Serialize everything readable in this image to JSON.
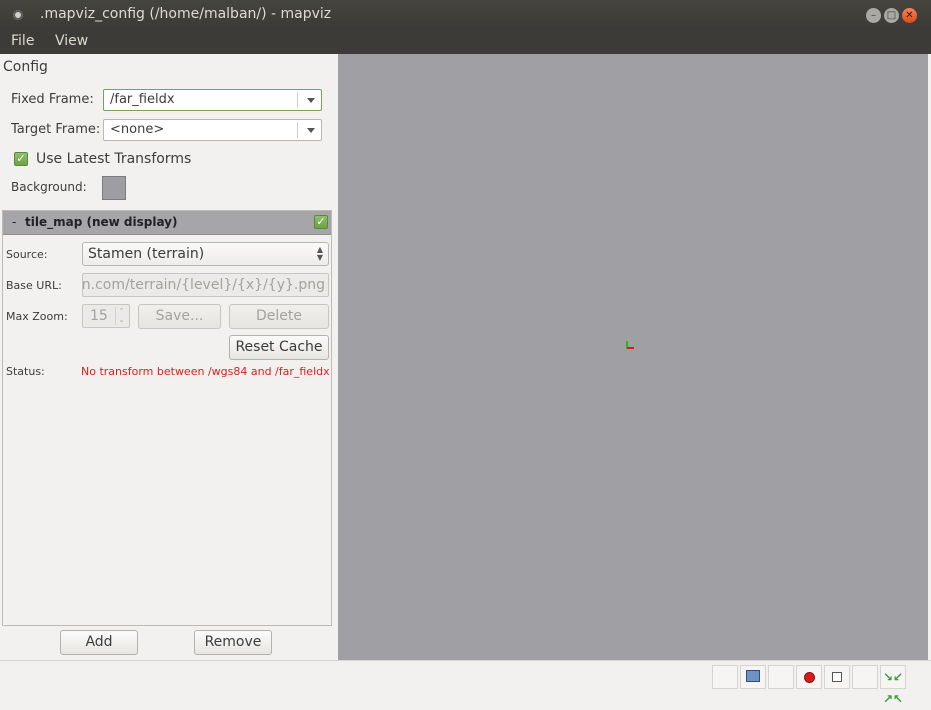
{
  "window": {
    "title": ".mapviz_config (/home/malban/) - mapviz"
  },
  "menu": {
    "file_label": "File",
    "view_label": "View"
  },
  "config": {
    "heading": "Config",
    "fixed_frame_label": "Fixed Frame:",
    "fixed_frame_value": "/far_fieldx",
    "target_frame_label": "Target Frame:",
    "target_frame_value": "<none>",
    "use_latest_label": "Use Latest Transforms",
    "use_latest_checked": true,
    "background_label": "Background:",
    "background_color": "#9e9da2"
  },
  "display": {
    "collapse_symbol": "-",
    "name": "tile_map (new display)",
    "enabled": true,
    "source_label": "Source:",
    "source_value": "Stamen (terrain)",
    "base_url_label": "Base URL:",
    "base_url_value": "amen.com/terrain/{level}/{x}/{y}.png",
    "max_zoom_label": "Max Zoom:",
    "max_zoom_value": "15",
    "save_label": "Save...",
    "delete_label": "Delete",
    "reset_cache_label": "Reset Cache",
    "status_label": "Status:",
    "status_text": "No transform between /wgs84 and /far_fieldx",
    "status_color": "#df2020"
  },
  "bottom_buttons": {
    "add_label": "Add",
    "remove_label": "Remove"
  },
  "viewport": {
    "background_color": "#a0a0a4"
  },
  "toolbar": {
    "icons": [
      "blank-icon",
      "screenshot-icon",
      "blank-icon",
      "record-icon",
      "stop-icon",
      "blank-icon",
      "fit-view-icon"
    ]
  }
}
